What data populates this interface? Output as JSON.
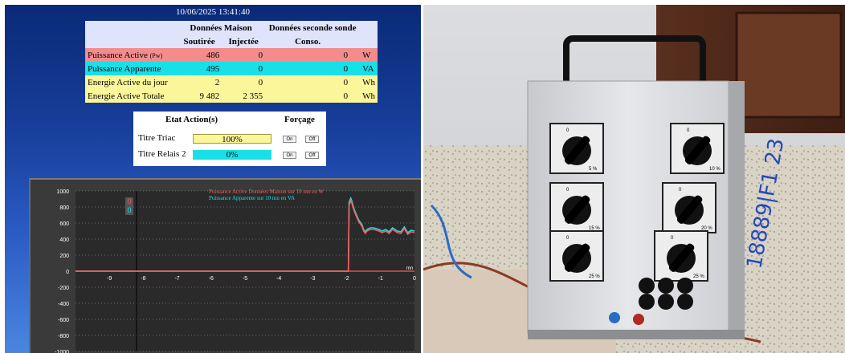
{
  "timestamp": "10/06/2025 13:41:40",
  "table": {
    "head1": [
      "Données Maison",
      "Données seconde sonde"
    ],
    "head2": [
      "Soutirée",
      "Injectée",
      "Conso."
    ],
    "rows": [
      {
        "label": "Puissance Active ",
        "label_small": "(Pw)",
        "soutiree": "486",
        "injectee": "0",
        "conso": "0",
        "unit": "W",
        "style": "pink"
      },
      {
        "label": "Puissance Apparente",
        "label_small": "",
        "soutiree": "495",
        "injectee": "0",
        "conso": "0",
        "unit": "VA",
        "style": "cyan"
      },
      {
        "label": "Energie Active du jour",
        "label_small": "",
        "soutiree": "2",
        "injectee": "0",
        "conso": "0",
        "unit": "Wh",
        "style": "yellow"
      },
      {
        "label": "Energie Active Totale",
        "label_small": "",
        "soutiree": "9 482",
        "injectee": "2 355",
        "conso": "0",
        "unit": "Wh",
        "style": "yellow"
      }
    ]
  },
  "actions": {
    "title": "Etat Action(s)",
    "forcage": "Forçage",
    "items": [
      {
        "label": "Titre Triac",
        "value": "100%",
        "fill": 1.0,
        "on": "On",
        "off": "Off"
      },
      {
        "label": "Titre Relais 2",
        "value": "0%",
        "fill": 1.0,
        "on": "On",
        "off": "Off"
      }
    ]
  },
  "chart_data": {
    "type": "line",
    "legend": [
      {
        "name": "Puissance Active Données Maison sur 10 mn en W",
        "color": "#ff5a5a"
      },
      {
        "name": "Puissance Apparente sur 10 mn en VA",
        "color": "#19e0e8"
      }
    ],
    "xlim": [
      -10,
      0
    ],
    "ylim": [
      -1000,
      1000
    ],
    "xticks": [
      -9,
      -8,
      -7,
      -6,
      -5,
      -4,
      -3,
      -2,
      -1,
      0
    ],
    "yticks": [
      1000,
      800,
      600,
      400,
      200,
      0,
      -200,
      -400,
      -600,
      -800,
      -1000
    ],
    "x_unit": "mn",
    "cursor": {
      "x": -8.2,
      "values": [
        "0",
        "0"
      ]
    },
    "series": [
      {
        "name": "Puissance Active Données Maison sur 10 mn en W",
        "color": "#ff5a5a",
        "x": [
          -10,
          -1.95,
          -1.93,
          -1.88,
          -1.85,
          -1.8,
          -1.75,
          -1.65,
          -1.55,
          -1.5,
          -1.45,
          -1.4,
          -1.3,
          -1.2,
          -1.05,
          -0.95,
          -0.85,
          -0.75,
          -0.65,
          -0.5,
          -0.4,
          -0.3,
          -0.2,
          -0.1,
          0
        ],
        "y": [
          0,
          0,
          820,
          880,
          850,
          780,
          720,
          620,
          560,
          500,
          470,
          500,
          520,
          520,
          500,
          480,
          500,
          470,
          520,
          480,
          470,
          530,
          460,
          490,
          480
        ]
      },
      {
        "name": "Puissance Apparente sur 10 mn en VA",
        "color": "#19e0e8",
        "x": [
          -10,
          -1.95,
          -1.93,
          -1.88,
          -1.85,
          -1.8,
          -1.75,
          -1.65,
          -1.55,
          -1.5,
          -1.45,
          -1.4,
          -1.3,
          -1.2,
          -1.05,
          -0.95,
          -0.85,
          -0.75,
          -0.65,
          -0.5,
          -0.4,
          -0.3,
          -0.2,
          -0.1,
          0
        ],
        "y": [
          0,
          0,
          860,
          910,
          880,
          800,
          740,
          640,
          580,
          520,
          490,
          520,
          540,
          540,
          520,
          500,
          520,
          490,
          540,
          500,
          490,
          550,
          480,
          510,
          500
        ]
      }
    ]
  },
  "photo": {
    "switches": [
      {
        "pos": "0",
        "pct": "5 %"
      },
      {
        "pos": "0",
        "pct": "10 %"
      },
      {
        "pos": "0",
        "pct": "15 %"
      },
      {
        "pos": "0",
        "pct": "20 %"
      },
      {
        "pos": "0",
        "pct": "25 %"
      },
      {
        "pos": "0",
        "pct": "25 %"
      }
    ],
    "handwriting": "18889|F1 23"
  }
}
